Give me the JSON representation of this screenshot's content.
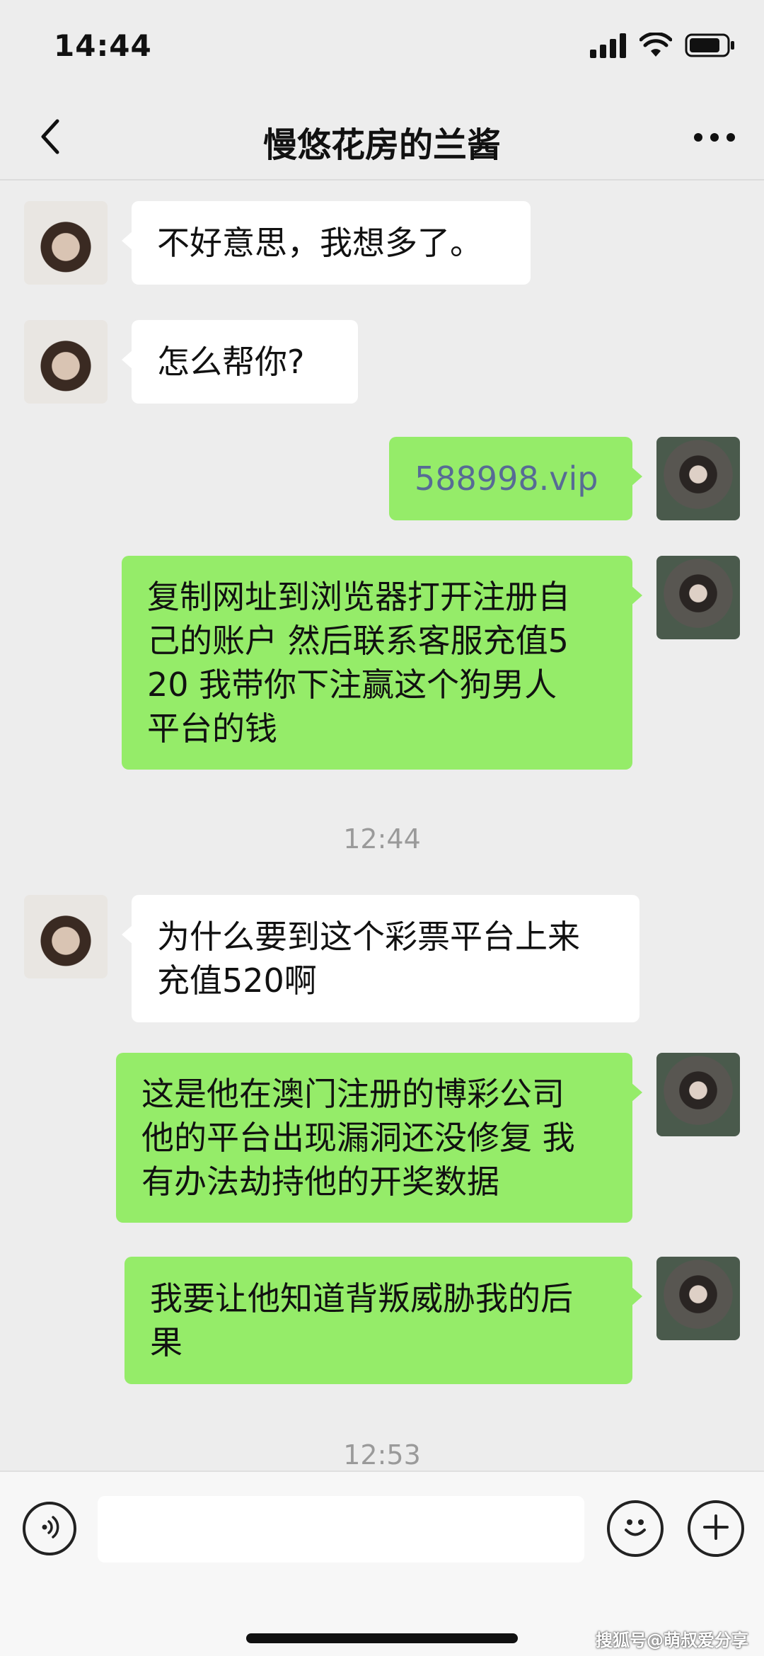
{
  "status_bar": {
    "time": "14:44"
  },
  "nav": {
    "title": "慢悠花房的兰酱"
  },
  "messages": [
    {
      "from": "contact",
      "text": "不好意思，我想多了。"
    },
    {
      "from": "contact",
      "text": "怎么帮你?"
    },
    {
      "from": "me",
      "text": "588998.vip"
    },
    {
      "from": "me",
      "lines": [
        "复制网址到浏览器打开注册自",
        "己的账户 然后联系客服充值5",
        "20 我带你下注赢这个狗男人",
        "平台的钱"
      ]
    },
    {
      "from": "contact",
      "lines": [
        "为什么要到这个彩票平台上来",
        "充值520啊"
      ]
    },
    {
      "from": "me",
      "lines": [
        "这是他在澳门注册的博彩公司",
        "他的平台出现漏洞还没修复 我",
        "有办法劫持他的开奖数据"
      ]
    },
    {
      "from": "me",
      "lines": [
        "我要让他知道背叛威胁我的后",
        "果"
      ]
    }
  ],
  "timestamps": [
    "12:44",
    "12:53"
  ],
  "input": {
    "placeholder": ""
  },
  "watermark": "搜狐号@萌叔爱分享",
  "colors": {
    "background": "#ededed",
    "outgoing_bubble": "#95ec69",
    "incoming_bubble": "#ffffff",
    "link": "#576b95"
  },
  "icons": [
    "back-icon",
    "more-icon",
    "voice-icon",
    "emoji-icon",
    "plus-icon",
    "signal-icon",
    "wifi-icon",
    "battery-icon"
  ]
}
